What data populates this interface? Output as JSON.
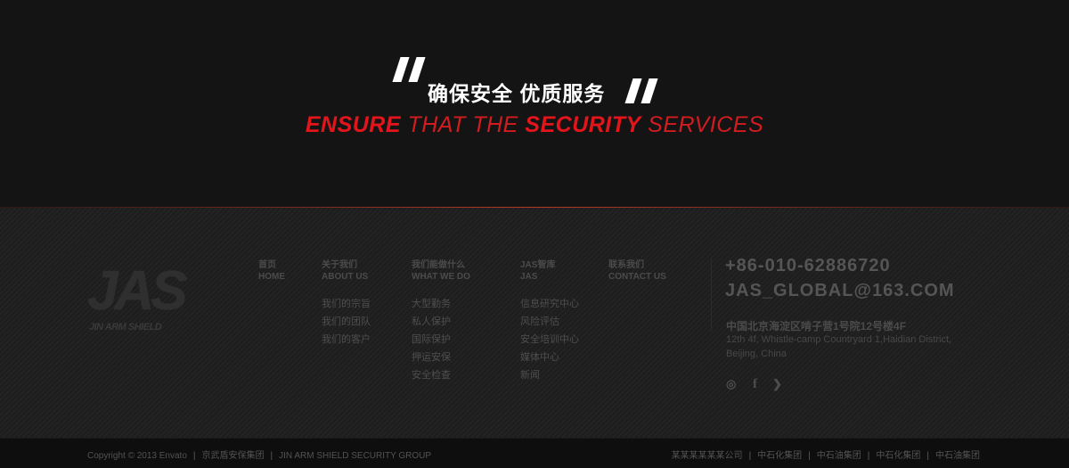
{
  "hero": {
    "slogan_cn": "确保安全 优质服务",
    "slogan_en": {
      "w1": "ENSURE",
      "w2": " THAT THE ",
      "w3": "SECURITY",
      "w4": " SERVICES"
    }
  },
  "logo": {
    "letters": "JAS",
    "caption": "JIN ARM SHIELD"
  },
  "nav": {
    "home": {
      "cn": "首页",
      "en": "HOME"
    },
    "about": {
      "cn": "关于我们",
      "en": "ABOUT US",
      "links": [
        "我们的宗旨",
        "我们的团队",
        "我们的客户"
      ]
    },
    "what": {
      "cn": "我们能做什么",
      "en": "WHAT WE DO",
      "links": [
        "大型勤务",
        "私人保护",
        "国际保护",
        "押运安保",
        "安全检查"
      ]
    },
    "jas": {
      "cn": "JAS智库",
      "en": "JAS",
      "links": [
        "信息研究中心",
        "风险评估",
        "安全培训中心",
        "媒体中心",
        "新闻"
      ]
    },
    "contact": {
      "cn": "联系我们",
      "en": "CONTACT US"
    }
  },
  "contact": {
    "phone": "+86-010-62886720",
    "email": "JAS_GLOBAL@163.COM",
    "address_cn": "中国北京海淀区啃子营1号院12号楼4F",
    "address_en": "12th 4f, Whistle-camp Countryard 1,Haidian District, Beijing, China"
  },
  "social": {
    "weibo": "weibo-icon",
    "facebook": "facebook-icon",
    "twitter": "twitter-icon"
  },
  "bottom": {
    "copyright": "Copyright © 2013 Envato",
    "company_cn": "京武盾安保集团",
    "company_en": "JIN ARM SHIELD SECURITY GROUP",
    "partners": [
      "某某某某某某公司",
      "中石化集团",
      "中石油集团",
      "中石化集团",
      "中石油集团"
    ]
  },
  "colors": {
    "accent_red": "#e3151b",
    "background": "#141415"
  }
}
